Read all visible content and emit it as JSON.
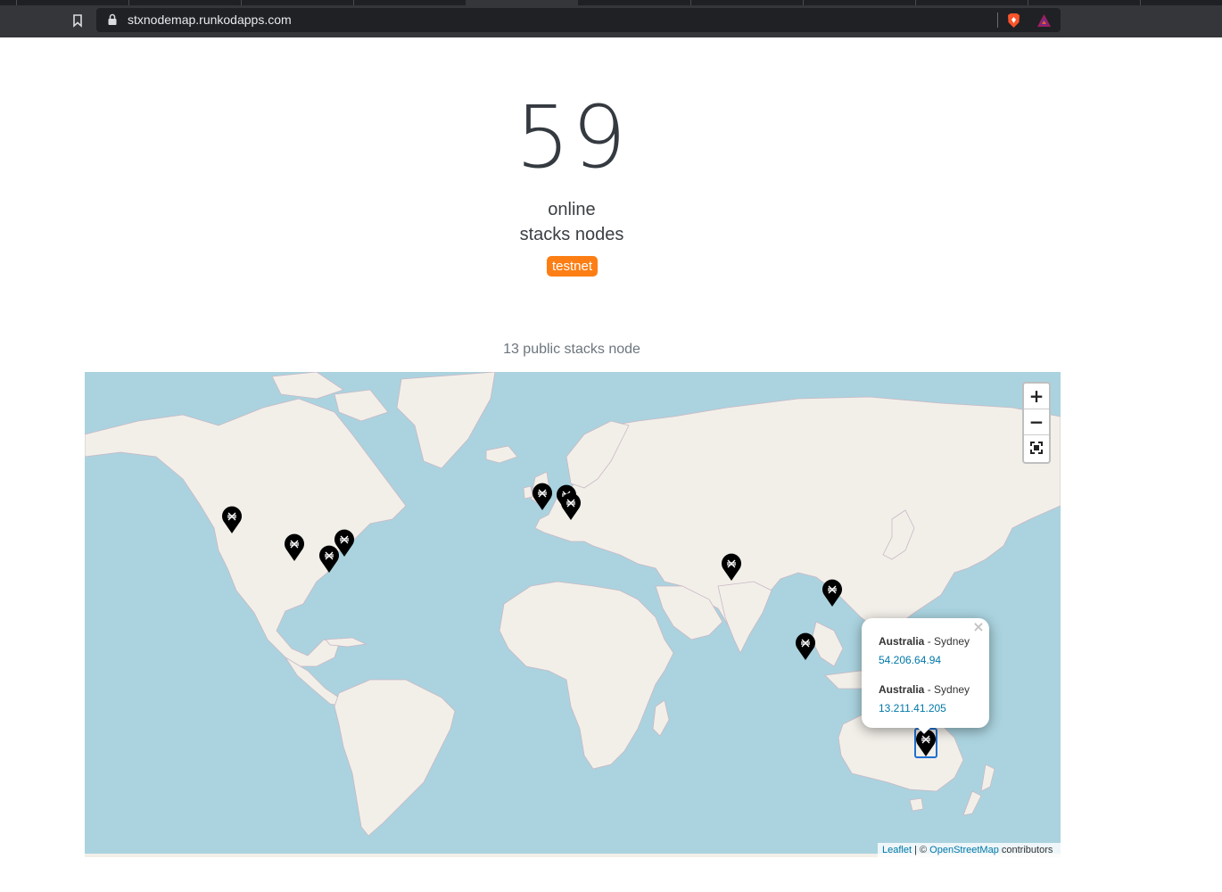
{
  "browser": {
    "url": "stxnodemap.runkodapps.com"
  },
  "stats": {
    "online_count": "59",
    "online_label": "online",
    "nodes_label": "stacks nodes",
    "network_badge": "testnet",
    "public_count_text": "13 public stacks node"
  },
  "map": {
    "zoom_in": "+",
    "zoom_out": "−",
    "fullscreen_icon": "fullscreen-icon",
    "colors": {
      "water": "#aad3df",
      "land": "#f2efe9",
      "marker": "#000000",
      "badge": "#fd7e14"
    },
    "markers": [
      {
        "name": "node-marker-us-west"
      },
      {
        "name": "node-marker-us-central"
      },
      {
        "name": "node-marker-us-east-1"
      },
      {
        "name": "node-marker-us-east-2"
      },
      {
        "name": "node-marker-uk"
      },
      {
        "name": "node-marker-netherlands"
      },
      {
        "name": "node-marker-germany"
      },
      {
        "name": "node-marker-india"
      },
      {
        "name": "node-marker-hongkong"
      },
      {
        "name": "node-marker-singapore"
      },
      {
        "name": "node-marker-sydney"
      }
    ],
    "popup": {
      "close": "×",
      "entries": [
        {
          "country": "Australia",
          "city": " - Sydney",
          "ip": "54.206.64.94"
        },
        {
          "country": "Australia",
          "city": " - Sydney",
          "ip": "13.211.41.205"
        }
      ]
    },
    "attribution": {
      "leaflet": "Leaflet",
      "separator": " | © ",
      "osm": "OpenStreetMap",
      "suffix": " contributors"
    }
  }
}
